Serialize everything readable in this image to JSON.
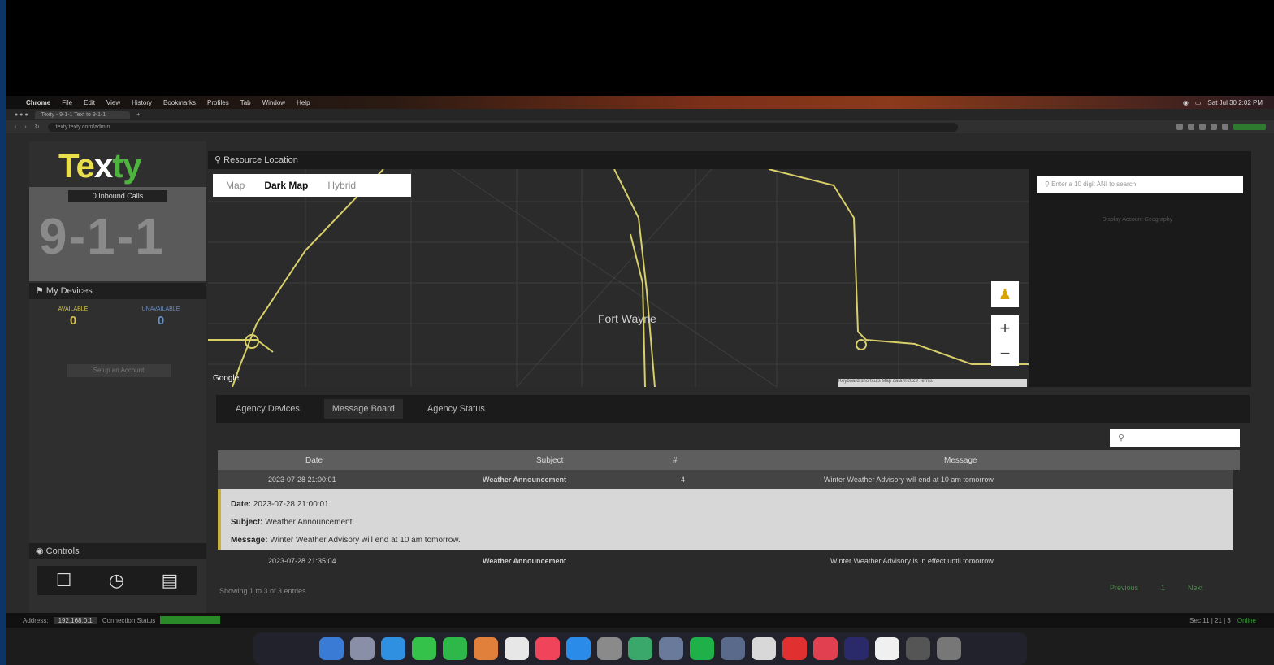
{
  "menubar": {
    "app": "Chrome",
    "items": [
      "File",
      "Edit",
      "View",
      "History",
      "Bookmarks",
      "Profiles",
      "Tab",
      "Window",
      "Help"
    ],
    "clock": "Sat Jul 30 2:02 PM"
  },
  "browser": {
    "tab_title": "Texty - 9-1-1 Text to 9-1-1",
    "url": "texty.texty.com/admin"
  },
  "sidebar": {
    "logo_a": "Te",
    "logo_x": "x",
    "logo_b": "ty",
    "inbound_label": "0 Inbound Calls",
    "big_number": "9-1-1",
    "devices_header": "My Devices",
    "device_1_label": "AVAILABLE",
    "device_1_value": "0",
    "device_2_label": "UNAVAILABLE",
    "device_2_value": "0",
    "setup_button": "Setup an Account",
    "controls_header": "Controls"
  },
  "map": {
    "header": "Resource Location",
    "types": [
      "Map",
      "Dark Map",
      "Hybrid"
    ],
    "active_type": "Dark Map",
    "city": "Fort Wayne",
    "google": "Google",
    "attribution": "Keyboard shortcuts  Map data ©2023  Terms",
    "search_placeholder": "Enter a 10 digit ANI to search",
    "side_button": "Display Account Geography"
  },
  "tabs": [
    "Agency Devices",
    "Message Board",
    "Agency Status"
  ],
  "active_tab": "Message Board",
  "table": {
    "search_placeholder": "",
    "columns": [
      "Date",
      "Subject",
      "#",
      "Message"
    ],
    "rows": [
      {
        "date": "2023-07-28 21:00:01",
        "subject": "Weather Announcement",
        "num": "4",
        "message": "Winter Weather Advisory will end at 10 am tomorrow."
      },
      {
        "date": "2023-07-28 21:35:04",
        "subject": "Weather Announcement",
        "num": "",
        "message": "Winter Weather Advisory is in effect until tomorrow."
      }
    ],
    "detail": {
      "date_label": "Date:",
      "date_value": "2023-07-28 21:00:01",
      "subject_label": "Subject:",
      "subject_value": "Weather Announcement",
      "message_label": "Message:",
      "message_value": "Winter Weather Advisory will end at 10 am tomorrow."
    },
    "footer": "Showing 1 to 3 of 3 entries",
    "pager": [
      "Previous",
      "1",
      "Next"
    ]
  },
  "statusbar": {
    "left_label": "Address:",
    "left_value": "192.168.0.1",
    "conn_label": "Connection Status",
    "right_text": "Sec 11 | 21 | 3",
    "right_status": "Online"
  },
  "colors": {
    "accent_yellow": "#e9df4a",
    "logo_green": "#4fb33f",
    "map_road": "#d8cf6a"
  }
}
